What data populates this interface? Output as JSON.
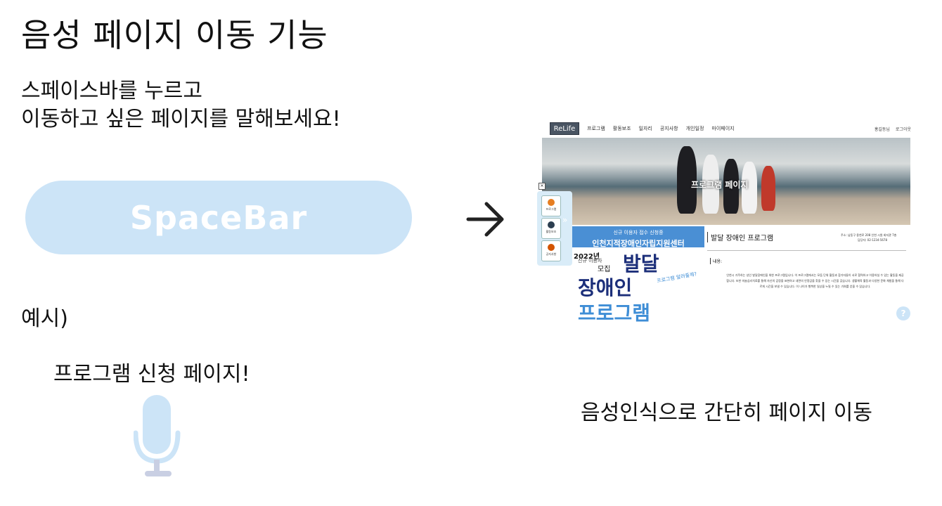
{
  "title": "음성 페이지 이동 기능",
  "instructions": {
    "line1": "스페이스바를 누르고",
    "line2": "이동하고 싶은 페이지를 말해보세요!"
  },
  "spacebar_label": "SpaceBar",
  "example": {
    "label": "예시)",
    "speech": "프로그램 신청 페이지!"
  },
  "caption": "음성인식으로 간단히 페이지 이동",
  "colors": {
    "accent_light_blue": "#cce4f7",
    "mic_stand": "#c9cfe3",
    "poster_blue": "#4a8fd4",
    "poster_navy": "#1c2f7a"
  },
  "icons": {
    "arrow": "arrow-right-icon",
    "mic": "microphone-icon",
    "help": "question-mark-icon"
  },
  "screenshot": {
    "logo": "ReLife",
    "nav": [
      "프로그램",
      "활동보조",
      "일자리",
      "공지사항",
      "개인일정",
      "마이페이지"
    ],
    "nav_right": [
      "홍길동님",
      "로그아웃"
    ],
    "hero_title": "프로그램 페이지",
    "side_menu": [
      "프로그램",
      "활동보조",
      "공지사항"
    ],
    "poster": {
      "subtitle": "신규 이용자 접수 신청중",
      "org": "인천지적장애인자립지원센터",
      "year": "2022년",
      "new_user": "신규 이용자",
      "recruit": "모집",
      "word1": "발달",
      "word2": "장애인",
      "word3": "프로그램",
      "handwriting": "프로그램 알려줄께?"
    },
    "detail": {
      "title": "발달 장애인 프로그램",
      "address": "주소: 남동구 용천로 208 인천 시원 회지관 7층",
      "tel": "담당자: 02-1234-5678",
      "content_label": "내용:",
      "body": "인천시 거주하는 성인 발달장애인을 위한 프로그램입니다. 이 프로그램에서는 모둠 단위 활동과 참가자들이 서로 협력하고 이용하실 수 있는 활동을 제공합니다. 또한 미술심리치료를 통해 자신의 감정을 표현하고 내면의 안정감을 찾을 수 있는 시간을 갖습니다. 생활체육 활동과 다양한 문화 체험을 통해 다르게 시간을 보낼 수 있습니다. 이 나이가 행복한 일상을 누릴 수 있는 기회를 얻을 수 있습니다."
    },
    "help": "?"
  }
}
